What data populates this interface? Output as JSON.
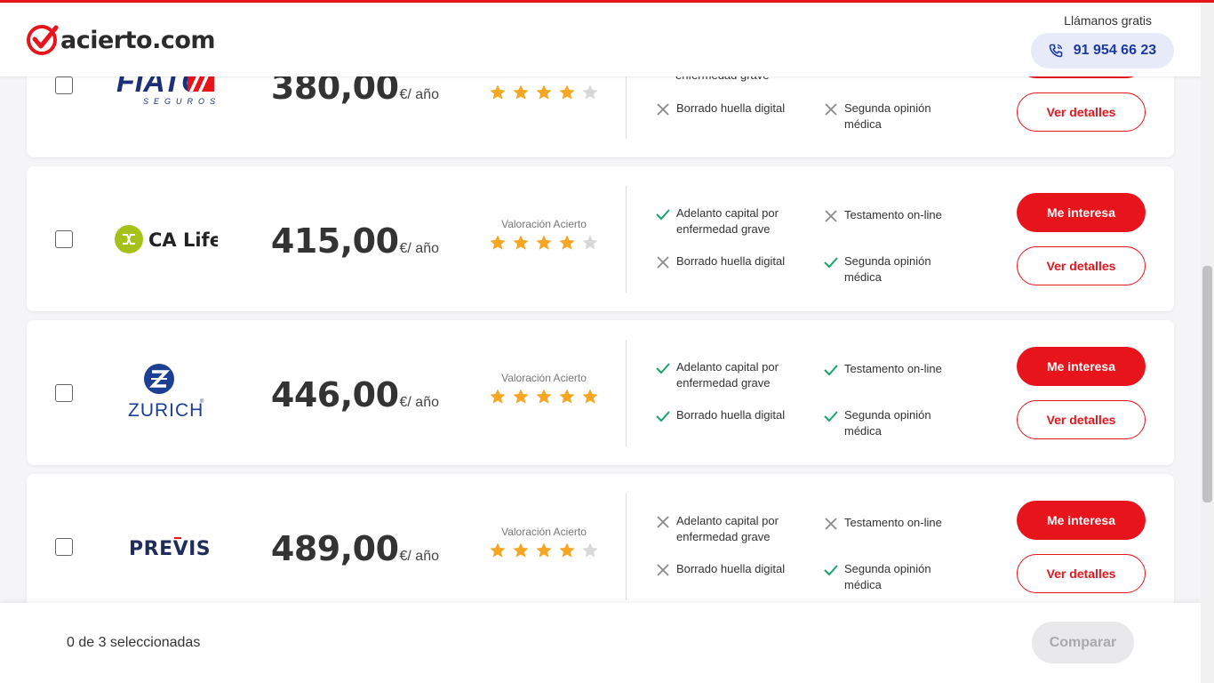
{
  "header": {
    "logo_text": "acierto.com",
    "call_label": "Llámanos gratis",
    "phone": "91 954 66 23"
  },
  "colors": {
    "accent": "#e8141c",
    "star": "#f5a623",
    "star_empty": "#d8d8d8",
    "check": "#1aa36b",
    "cross": "#8a8a8a"
  },
  "rating_label": "Valoración Acierto",
  "cards": [
    {
      "brand": "FIATC SEGUROS",
      "brand_name": "FIATC",
      "brand_sub": "SEGUROS",
      "price": "380,00",
      "unit": "€/ año",
      "stars": 4,
      "features": [
        {
          "label": "enfermedad grave",
          "ok": true
        },
        {
          "label": "Borrado huella digital",
          "ok": false
        },
        {
          "label": "Segunda opinión médica",
          "ok": false
        }
      ],
      "details_label": "Ver detalles"
    },
    {
      "brand": "CA Life",
      "price": "415,00",
      "unit": "€/ año",
      "stars": 4,
      "features": [
        {
          "label": "Adelanto capital por enfermedad grave",
          "ok": true
        },
        {
          "label": "Testamento on-line",
          "ok": false
        },
        {
          "label": "Borrado huella digital",
          "ok": false
        },
        {
          "label": "Segunda opinión médica",
          "ok": true
        }
      ],
      "interest_label": "Me interesa",
      "details_label": "Ver detalles"
    },
    {
      "brand": "ZURICH",
      "price": "446,00",
      "unit": "€/ año",
      "stars": 5,
      "features": [
        {
          "label": "Adelanto capital por enfermedad grave",
          "ok": true
        },
        {
          "label": "Testamento on-line",
          "ok": true
        },
        {
          "label": "Borrado huella digital",
          "ok": true
        },
        {
          "label": "Segunda opinión médica",
          "ok": true
        }
      ],
      "interest_label": "Me interesa",
      "details_label": "Ver detalles"
    },
    {
      "brand": "PREVIS",
      "price": "489,00",
      "unit": "€/ año",
      "stars": 4,
      "features": [
        {
          "label": "Adelanto capital por enfermedad grave",
          "ok": false
        },
        {
          "label": "Testamento on-line",
          "ok": false
        },
        {
          "label": "Borrado huella digital",
          "ok": false
        },
        {
          "label": "Segunda opinión médica",
          "ok": true
        }
      ],
      "interest_label": "Me interesa",
      "details_label": "Ver detalles"
    }
  ],
  "footer": {
    "selected_text": "0 de 3 seleccionadas",
    "compare_label": "Comparar"
  }
}
